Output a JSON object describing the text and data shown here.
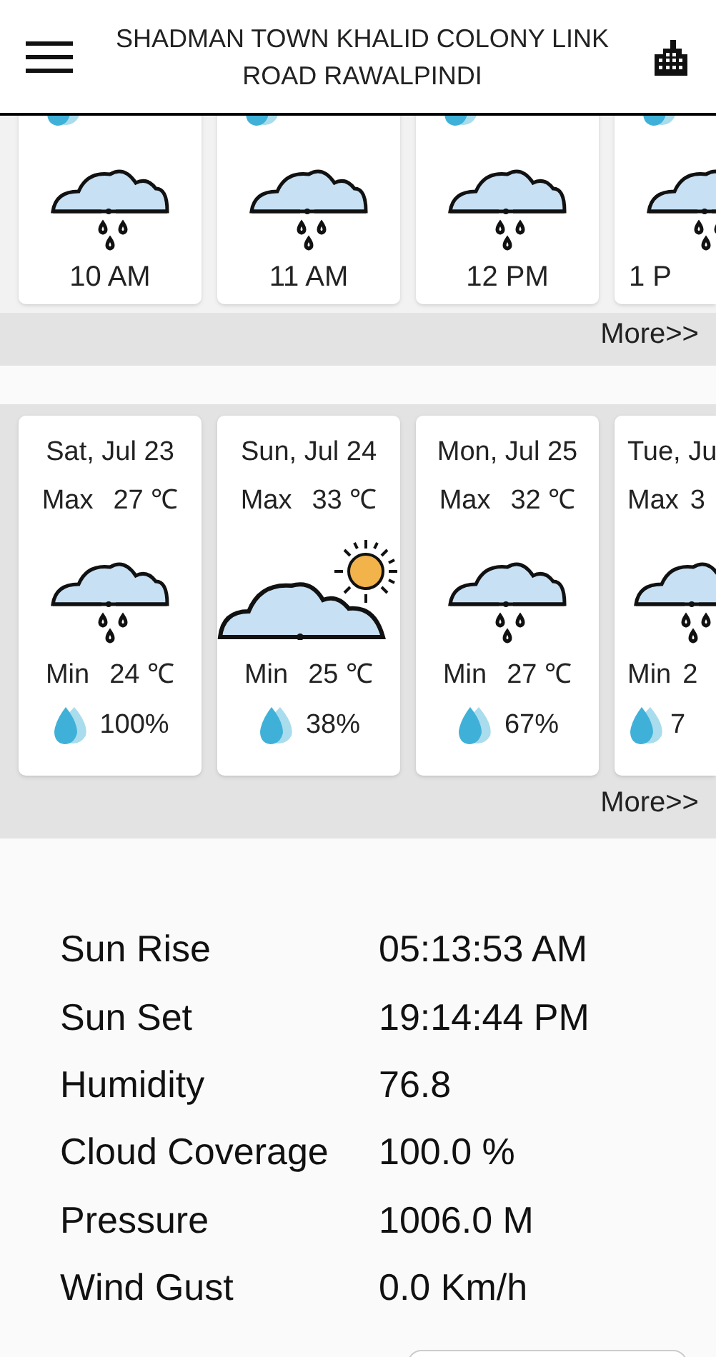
{
  "header": {
    "title": "SHADMAN TOWN KHALID COLONY LINK ROAD RAWALPINDI"
  },
  "hourly": {
    "cards": [
      {
        "time": "10 AM",
        "kind": "rain"
      },
      {
        "time": "11 AM",
        "kind": "rain"
      },
      {
        "time": "12 PM",
        "kind": "rain"
      },
      {
        "time": "1 P",
        "kind": "rain"
      }
    ],
    "more": "More>>"
  },
  "daily": {
    "cards": [
      {
        "date": "Sat, Jul 23",
        "max_label": "Max",
        "max": "27 ℃",
        "kind": "rain",
        "min_label": "Min",
        "min": "24 ℃",
        "precip": "100%"
      },
      {
        "date": "Sun, Jul 24",
        "max_label": "Max",
        "max": "33 ℃",
        "kind": "partly_sunny",
        "min_label": "Min",
        "min": "25 ℃",
        "precip": "38%"
      },
      {
        "date": "Mon, Jul 25",
        "max_label": "Max",
        "max": "32 ℃",
        "kind": "rain",
        "min_label": "Min",
        "min": "27 ℃",
        "precip": "67%"
      },
      {
        "date": "Tue, Ju",
        "max_label": "Max",
        "max": "3",
        "kind": "rain",
        "min_label": "Min",
        "min": "2",
        "precip": "7"
      }
    ],
    "more": "More>>"
  },
  "details": [
    {
      "label": "Sun Rise",
      "value": "05:13:53 AM"
    },
    {
      "label": "Sun Set",
      "value": "19:14:44 PM"
    },
    {
      "label": "Humidity",
      "value": "76.8"
    },
    {
      "label": "Cloud Coverage",
      "value": "100.0 %"
    },
    {
      "label": "Pressure",
      "value": "1006.0 M"
    },
    {
      "label": "Wind Gust",
      "value": "0.0 Km/h"
    }
  ]
}
